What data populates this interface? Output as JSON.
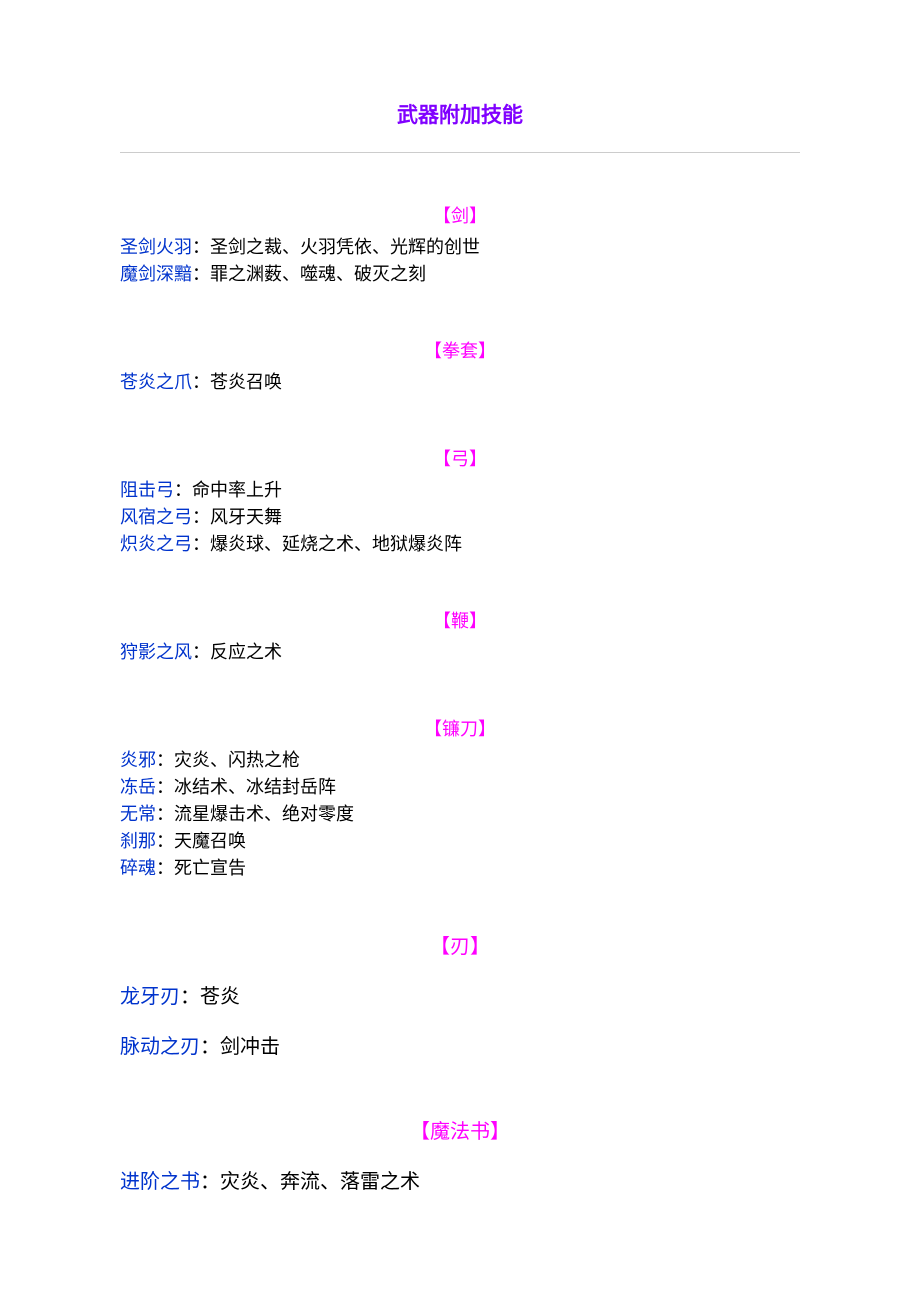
{
  "title": "武器附加技能",
  "sections": [
    {
      "header": "【剑】",
      "style": "compact",
      "entries": [
        {
          "weapon": "圣剑火羽",
          "sep": "：",
          "skills": "圣剑之裁、火羽凭依、光辉的创世"
        },
        {
          "weapon": "魔剑深黯",
          "sep": "：",
          "skills": "罪之渊薮、噬魂、破灭之刻"
        }
      ]
    },
    {
      "header": "【拳套】",
      "style": "compact",
      "entries": [
        {
          "weapon": "苍炎之爪",
          "sep": "：",
          "skills": "苍炎召唤"
        }
      ]
    },
    {
      "header": "【弓】",
      "style": "compact",
      "entries": [
        {
          "weapon": "阻击弓",
          "sep": "：",
          "skills": "命中率上升"
        },
        {
          "weapon": "风宿之弓",
          "sep": "：",
          "skills": "风牙天舞"
        },
        {
          "weapon": "炽炎之弓",
          "sep": "：",
          "skills": "爆炎球、延烧之术、地狱爆炎阵"
        }
      ]
    },
    {
      "header": "【鞭】",
      "style": "compact",
      "entries": [
        {
          "weapon": "狩影之风",
          "sep": "：",
          "skills": "反应之术"
        }
      ]
    },
    {
      "header": "【镰刀】",
      "style": "compact",
      "entries": [
        {
          "weapon": "炎邪",
          "sep": "：",
          "skills": "灾炎、闪热之枪"
        },
        {
          "weapon": "冻岳",
          "sep": "：",
          "skills": "冰结术、冰结封岳阵"
        },
        {
          "weapon": "无常",
          "sep": "：",
          "skills": "流星爆击术、绝对零度"
        },
        {
          "weapon": "刹那",
          "sep": "：",
          "skills": "天魔召唤"
        },
        {
          "weapon": "碎魂",
          "sep": "：",
          "skills": "死亡宣告"
        }
      ]
    },
    {
      "header": "【刃】",
      "style": "spaced",
      "entries": [
        {
          "weapon": "龙牙刃",
          "sep": "：",
          "skills": "苍炎"
        },
        {
          "weapon": "脉动之刃",
          "sep": "：",
          "skills": "剑冲击"
        }
      ]
    },
    {
      "header": "【魔法书】",
      "style": "spaced",
      "entries": [
        {
          "weapon": "进阶之书",
          "sep": "：",
          "skills": "灾炎、奔流、落雷之术"
        }
      ]
    }
  ]
}
